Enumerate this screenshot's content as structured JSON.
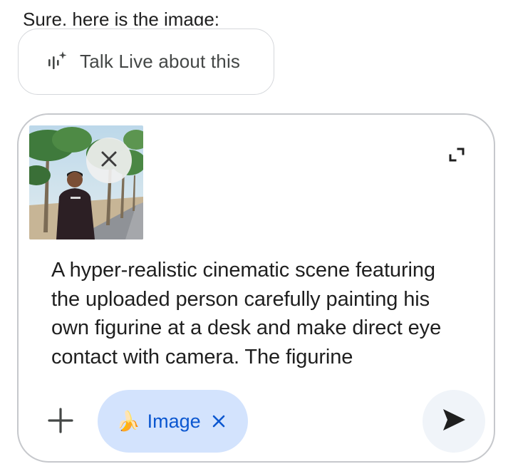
{
  "response": {
    "partial_text": "Sure, here is the image:"
  },
  "live_chip": {
    "label": "Talk Live about this",
    "icon": "live-waveform-sparkle-icon"
  },
  "composer": {
    "attachment": {
      "icon_remove": "close-icon",
      "icon_expand": "expand-icon"
    },
    "prompt_text": "A hyper-realistic cinematic scene featuring the uploaded person carefully painting his own figurine at a desk and make direct eye contact with camera. The figurine",
    "add_icon": "plus-icon",
    "tool_chip": {
      "emoji": "🍌",
      "label": "Image",
      "remove_icon": "close-icon",
      "color": "#0b57d0",
      "background": "#d3e3fd"
    },
    "send_icon": "send-icon"
  }
}
